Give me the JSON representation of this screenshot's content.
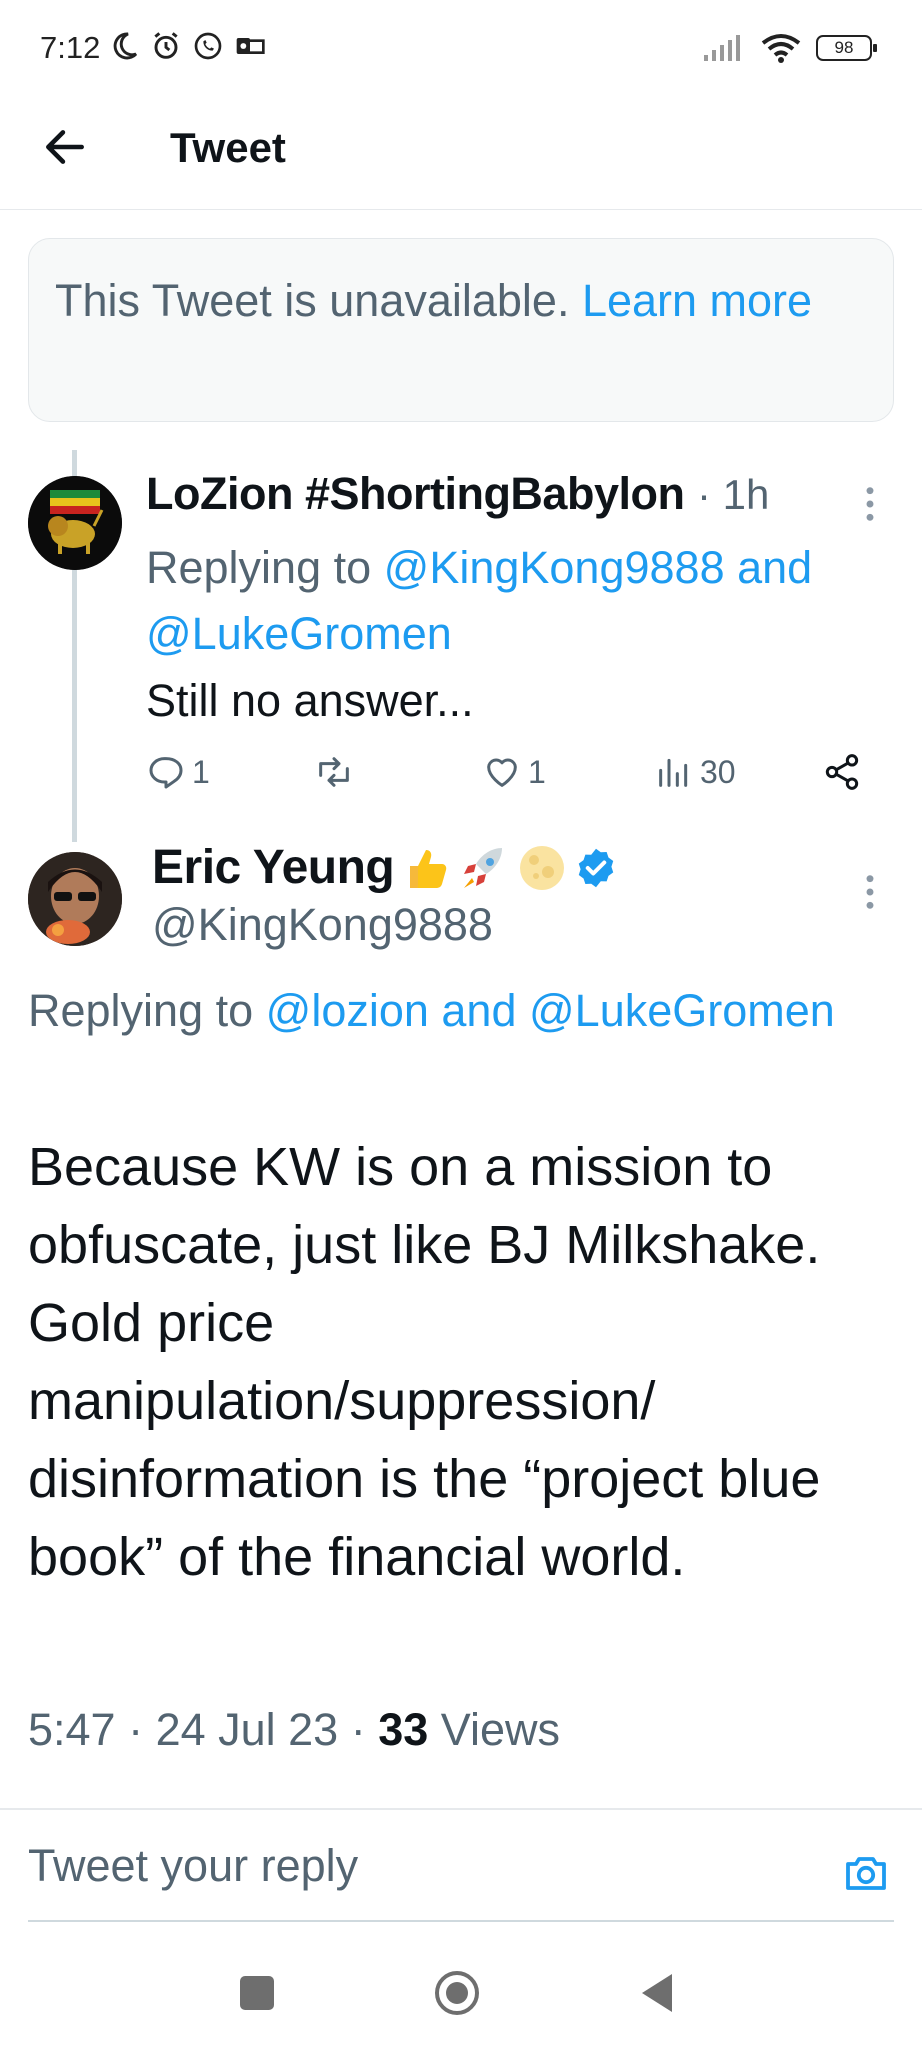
{
  "status_bar": {
    "time": "7:12",
    "battery": "98"
  },
  "header": {
    "title": "Tweet"
  },
  "unavailable": {
    "text": "This Tweet is unavailable. ",
    "link": "Learn more"
  },
  "reply": {
    "name": "LoZion #ShortingBabylon",
    "time": "· 1h",
    "replying_prefix": "Replying to ",
    "replying_to": "@KingKong9888 and @LukeGromen",
    "text": "Still no answer...",
    "actions": {
      "replies": "1",
      "likes": "1",
      "views": "30"
    }
  },
  "main_tweet": {
    "name": "Eric Yeung",
    "handle": "@KingKong9888",
    "replying_prefix": "Replying to ",
    "replying_to": "@lozion and @LukeGromen",
    "text": "Because KW is on a mission to obfuscate, just like BJ Milkshake. Gold price manipulation/suppression/ disinformation is the “project blue book” of the financial world.",
    "time": "5:47 · 24 Jul 23 · ",
    "views_count": "33",
    "views_label": " Views"
  },
  "reply_box": {
    "placeholder": "Tweet your reply"
  },
  "icons": [
    "back-arrow-icon",
    "more-icon",
    "reply-icon",
    "retweet-icon",
    "like-icon",
    "views-icon",
    "share-icon",
    "verified-icon",
    "camera-icon"
  ],
  "colors": {
    "accent": "#1d9bf0",
    "secondary_text": "#536471",
    "primary_text": "#0f1419"
  }
}
